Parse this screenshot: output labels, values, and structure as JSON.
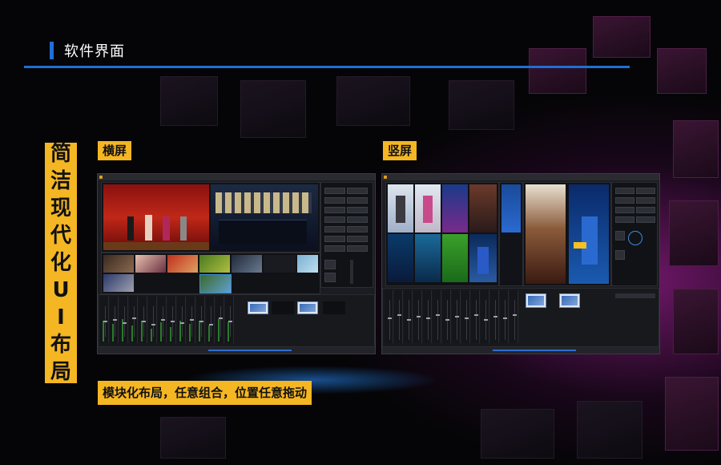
{
  "header": {
    "title": "软件界面",
    "accent_color": "#1e6fd8"
  },
  "side_banner": {
    "chars": [
      "简",
      "洁",
      "现",
      "代",
      "化",
      "U",
      "I",
      "布",
      "局"
    ]
  },
  "screens": {
    "landscape": {
      "label": "横屏"
    },
    "portrait": {
      "label": "竖屏"
    }
  },
  "caption": "模块化布局，任意组合，位置任意拖动",
  "colors": {
    "highlight": "#f5b623",
    "background": "#050507",
    "glow": "#961e8c"
  }
}
